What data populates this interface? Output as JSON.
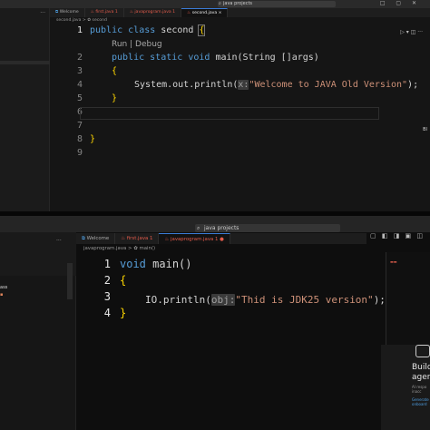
{
  "top": {
    "search_label": "java projects",
    "window_controls": "□ ▢ ✕",
    "tabs": [
      {
        "label": "Welcome",
        "icon": "vscode-logo-icon"
      },
      {
        "label": "first.java 1",
        "icon": "java-icon"
      },
      {
        "label": "javaprogram.java 1",
        "icon": "java-icon"
      },
      {
        "label": "second.java ×",
        "icon": "java-icon",
        "active": true
      }
    ],
    "breadcrumb": "second.java > ✿ second",
    "sidebar_dots": "···",
    "code": {
      "line_numbers": [
        "1",
        "2",
        "3",
        "4",
        "5",
        "6",
        "7",
        "8",
        "9"
      ],
      "codelens": "Run | Debug",
      "line1_kw1": "public",
      "line1_kw2": "class",
      "line1_name": "second",
      "line1_brace": "{",
      "line2_kw1": "public",
      "line2_kw2": "static",
      "line2_kw3": "void",
      "line2_rest": "main(String []args)",
      "line3": "{",
      "line4_call": "System.out.println(",
      "line4_hint": "x:",
      "line4_str": "\"Welcome to JAVA Old Version\"",
      "line4_end": ");",
      "line5": "}",
      "line8": "}"
    },
    "right_mark": "Bl"
  },
  "bottom": {
    "search_label": "java projects",
    "tabs": [
      {
        "label": "Welcome"
      },
      {
        "label": "first.java 1"
      },
      {
        "label": "javaprogram.java 1 ●",
        "active": true
      }
    ],
    "breadcrumb": "javaprogram.java > ✿ main()",
    "sidebar_label_1": "ass",
    "sidebar_dots": "···",
    "code": {
      "line_numbers": [
        "1",
        "2",
        "3",
        "4"
      ],
      "line1_kw": "void",
      "line1_rest": "main()",
      "line2": "{",
      "line3_call": "IO.println(",
      "line3_hint": "obj:",
      "line3_str": "\"Thid is JDK25 version\"",
      "line3_end": ");",
      "line4": "}"
    },
    "chat_title": "Build agent",
    "chat_sub": "AI respo inacc",
    "chat_link": "Generate onboard",
    "colors": {
      "keyword": "#569cd6",
      "string": "#ce9178",
      "bracket": "#ffd700",
      "error": "#e35b4b"
    }
  }
}
